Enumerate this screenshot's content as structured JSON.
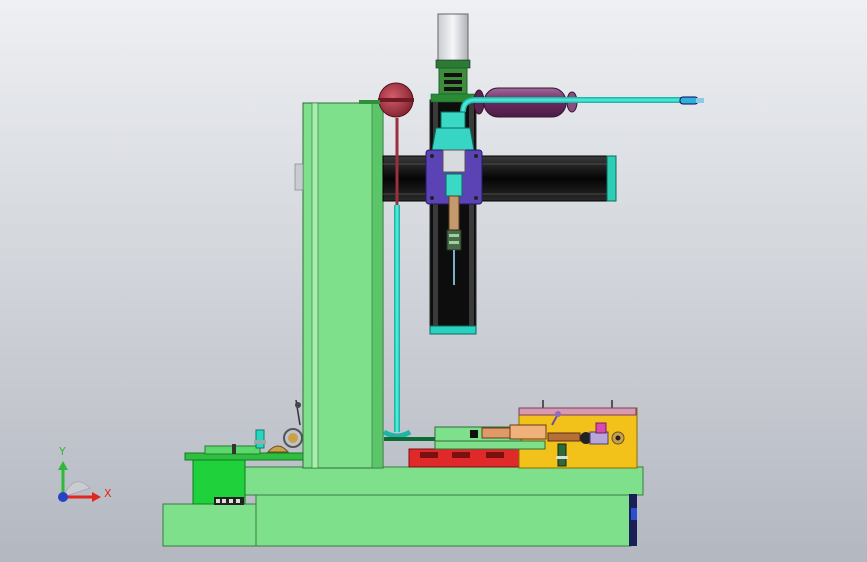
{
  "triad": {
    "x_label": "X",
    "y_label": "Y"
  },
  "colors": {
    "background_top": "#e8eaee",
    "background_bottom": "#b9bcc4",
    "frame_green": "#7fe08c",
    "frame_dark_green": "#1fbf3a",
    "motor_silver": "#dfe3e6",
    "coupler_green": "#3f8d3a",
    "rail_black": "#111111",
    "carriage_purple": "#5b43b5",
    "nozzle_teal": "#2fd6c5",
    "gauge_red": "#b13a4a",
    "tank_purple": "#7a3b6e",
    "fixture_yellow": "#f2c21b",
    "base_red": "#e02a2a",
    "pink_plate": "#d89ab3",
    "axis_x": "#e0261e",
    "axis_y": "#2fb83a",
    "axis_origin": "#2741c8"
  }
}
